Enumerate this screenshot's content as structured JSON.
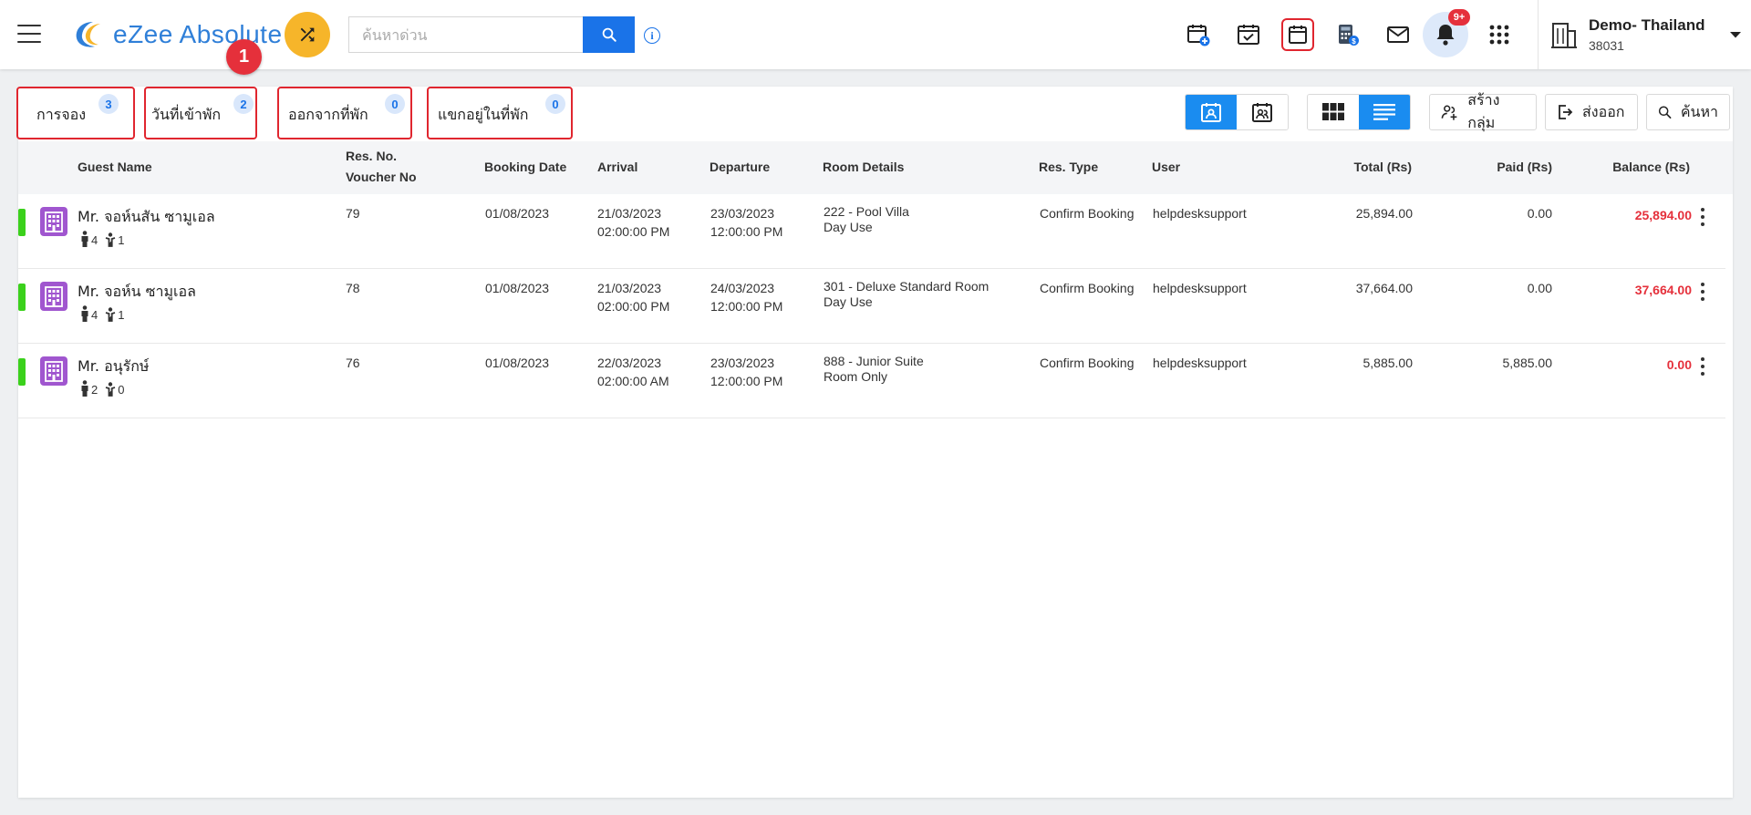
{
  "header": {
    "logo_text": "eZee Absolute",
    "step_marker": "1",
    "search": {
      "placeholder": "ค้นหาด่วน",
      "value": ""
    },
    "notification_count": "9+",
    "property": {
      "name": "Demo- Thailand",
      "id": "38031"
    }
  },
  "tabs": [
    {
      "label": "การจอง",
      "count": "3"
    },
    {
      "label": "วันที่เข้าพัก",
      "count": "2"
    },
    {
      "label": "ออกจากที่พัก",
      "count": "0"
    },
    {
      "label": "แขกอยู่ในที่พัก",
      "count": "0"
    }
  ],
  "toolbar": {
    "create_group_label": "สร้างกลุ่ม",
    "export_label": "ส่งออก",
    "search_label": "ค้นหา"
  },
  "table": {
    "headers": {
      "guest_name": "Guest Name",
      "res_no": "Res. No.",
      "voucher_no": "Voucher No",
      "booking_date": "Booking Date",
      "arrival": "Arrival",
      "departure": "Departure",
      "room_details": "Room Details",
      "res_type": "Res. Type",
      "user": "User",
      "total": "Total (Rs)",
      "paid": "Paid (Rs)",
      "balance": "Balance (Rs)"
    },
    "rows": [
      {
        "guest_name": "Mr. จอห์นสัน ซามูเอล",
        "adults": "4",
        "children": "1",
        "res_no": "79",
        "booking_date": "01/08/2023",
        "arrival_date": "21/03/2023",
        "arrival_time": "02:00:00 PM",
        "departure_date": "23/03/2023",
        "departure_time": "12:00:00 PM",
        "room": "222 - Pool Villa",
        "rate_plan": "Day Use",
        "res_type": "Confirm Booking",
        "user": "helpdesksupport",
        "total": "25,894.00",
        "paid": "0.00",
        "balance": "25,894.00"
      },
      {
        "guest_name": "Mr. จอห์น ซามูเอล",
        "adults": "4",
        "children": "1",
        "res_no": "78",
        "booking_date": "01/08/2023",
        "arrival_date": "21/03/2023",
        "arrival_time": "02:00:00 PM",
        "departure_date": "24/03/2023",
        "departure_time": "12:00:00 PM",
        "room": "301 - Deluxe Standard Room",
        "rate_plan": "Day Use",
        "res_type": "Confirm Booking",
        "user": "helpdesksupport",
        "total": "37,664.00",
        "paid": "0.00",
        "balance": "37,664.00"
      },
      {
        "guest_name": "Mr. อนุรักษ์",
        "adults": "2",
        "children": "0",
        "res_no": "76",
        "booking_date": "01/08/2023",
        "arrival_date": "22/03/2023",
        "arrival_time": "02:00:00 AM",
        "departure_date": "23/03/2023",
        "departure_time": "12:00:00 PM",
        "room": "888 - Junior Suite",
        "rate_plan": "Room Only",
        "res_type": "Confirm Booking",
        "user": "helpdesksupport",
        "total": "5,885.00",
        "paid": "5,885.00",
        "balance": "0.00"
      }
    ]
  },
  "colors": {
    "primary": "#1a73e8",
    "accent_yellow": "#f6b52a",
    "highlight_red": "#e0262f",
    "balance_red": "#e5303b",
    "status_green": "#3bd11c",
    "room_icon_purple": "#a056cf"
  }
}
